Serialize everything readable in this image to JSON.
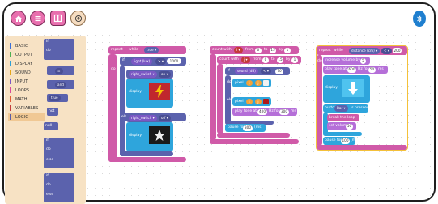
{
  "toolbar": {
    "home_icon": "home-icon",
    "menu_icon": "menu-icon",
    "layout_icon": "split-layout-icon",
    "upload_icon": "upload-icon",
    "bluetooth_icon": "bluetooth-icon"
  },
  "categories": [
    {
      "label": "BASIC",
      "color": "#3a6fd8"
    },
    {
      "label": "OUTPUT",
      "color": "#4caf50"
    },
    {
      "label": "DISPLAY",
      "color": "#2c9fd6"
    },
    {
      "label": "SOUND",
      "color": "#e6a619"
    },
    {
      "label": "INPUT",
      "color": "#7b58c4"
    },
    {
      "label": "LOOPS",
      "color": "#d9499b"
    },
    {
      "label": "MATH",
      "color": "#e05b35"
    },
    {
      "label": "VARIABLES",
      "color": "#c43b3b"
    },
    {
      "label": "LOGIC",
      "color": "#5a5ca6"
    }
  ],
  "flyout": {
    "if_label": "if",
    "do_label": "do",
    "else_label": "else",
    "and_label": "and",
    "true_label": "true",
    "not_label": "not",
    "null_label": "null",
    "compare_label": "="
  },
  "colors": {
    "loop": "#d05aa8",
    "logic": "#5b62ad",
    "display": "#2ea5dc",
    "sound": "#b56fd8",
    "math": "#5a60b8",
    "input": "#7b58c4",
    "orange": "#f2a23a"
  },
  "stack1": {
    "repeat_label": "repeat",
    "while_label": "while",
    "true_label": "true",
    "if_label": "if",
    "light_label": "light (lux)",
    "gt_label": ">",
    "threshold": "1000",
    "do_label": "do",
    "switch1": "right_switch",
    "on": "on",
    "display_label": "display",
    "else_label": "else",
    "switch2": "right_switch",
    "off": "off",
    "display2_label": "display"
  },
  "stack2": {
    "count_label": "count with",
    "var1": "i",
    "from_label": "from",
    "from1": "0",
    "to_label": "to",
    "to1": "15",
    "by_label": "by",
    "by1": "1",
    "count2_label": "count with",
    "var2": "j",
    "from2": "0",
    "to2": "15",
    "by2": "1",
    "if_label": "if",
    "sound_label": "sound (dB)",
    "lt_label": "<",
    "sound_threshold": "70",
    "do_label": "do",
    "pixel_label": "pixel",
    "pixel_x": "i",
    "pixel_y": "j",
    "else_label": "else",
    "pixel2_label": "pixel",
    "play_label": "play tone at",
    "hz": "400",
    "for_label": "Hz for",
    "duration": "300",
    "ms": "ms",
    "pause_label": "pause for",
    "pause_ms": "300",
    "pause_unit": "(ms)"
  },
  "stack3": {
    "repeat_label": "repeat",
    "while_label": "while",
    "distance_label": "distance (cm)",
    "lt_label": "<",
    "distance_val": "200",
    "do_label": "do",
    "increase_label": "increase volume by",
    "increase_val": "5",
    "play_label": "play tone at",
    "hz": "600",
    "hzfor_label": "Hz for",
    "duration": "50",
    "ms": "ms",
    "display_label": "display",
    "button_label": "button",
    "button_name": "Bar",
    "pressed_label": "is pressed",
    "break_label": "break the loop",
    "set_volume_label": "set volume",
    "volume_val": "50",
    "pause_label": "pause for",
    "pause_ms": "100",
    "pause_unit": "(ms)"
  }
}
